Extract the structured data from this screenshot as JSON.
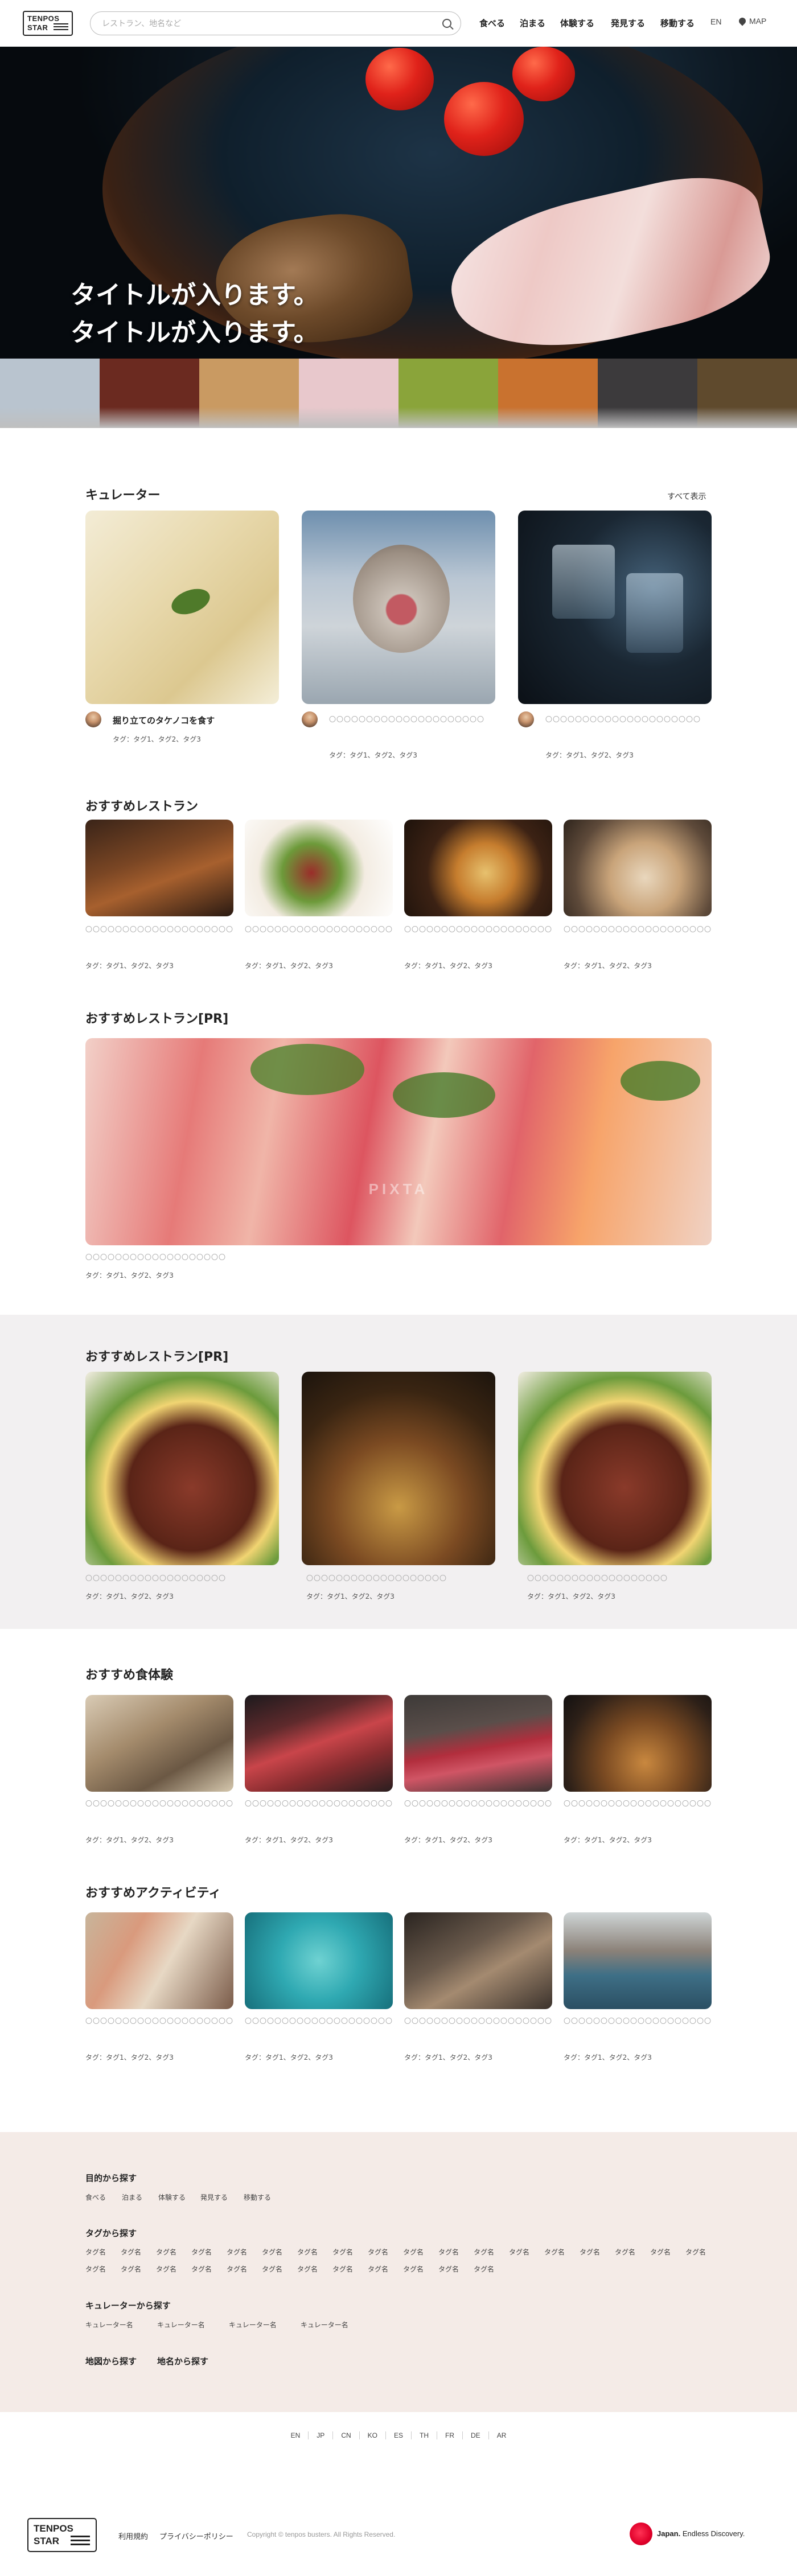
{
  "header": {
    "logo_line1": "TENPOS",
    "logo_line2": "STAR",
    "search_placeholder": "レストラン、地名など",
    "nav": [
      "食べる",
      "泊まる",
      "体験する",
      "発見する",
      "移動する"
    ],
    "lang": "EN",
    "map": "MAP"
  },
  "hero": {
    "title_line1": "タイトルが入ります。",
    "title_line2": "タイトルが入ります。"
  },
  "strip_colors": [
    "#b9c4cf",
    "#6b2a20",
    "#c99a62",
    "#e8c8cc",
    "#8aa43a",
    "#c9722f",
    "#3c3a3c",
    "#5f4a2d"
  ],
  "curators": {
    "title": "キュレーター",
    "see_all": "すべて表示",
    "items": [
      {
        "name": "掘り立てのタケノコを食す",
        "tags": "タグ：タグ1、タグ2、タグ3"
      },
      {
        "name": "〇〇〇〇〇〇〇〇〇〇〇〇〇〇〇〇〇〇〇〇〇",
        "tags": "タグ：タグ1、タグ2、タグ3"
      },
      {
        "name": "〇〇〇〇〇〇〇〇〇〇〇〇〇〇〇〇〇〇〇〇〇",
        "tags": "タグ：タグ1、タグ2、タグ3"
      }
    ]
  },
  "restaurants": {
    "title": "おすすめレストラン",
    "items": [
      {
        "name": "〇〇〇〇〇〇〇〇〇〇〇〇〇〇〇〇〇〇〇〇",
        "tags": "タグ：タグ1、タグ2、タグ3"
      },
      {
        "name": "〇〇〇〇〇〇〇〇〇〇〇〇〇〇〇〇〇〇〇〇",
        "tags": "タグ：タグ1、タグ2、タグ3"
      },
      {
        "name": "〇〇〇〇〇〇〇〇〇〇〇〇〇〇〇〇〇〇〇〇",
        "tags": "タグ：タグ1、タグ2、タグ3"
      },
      {
        "name": "〇〇〇〇〇〇〇〇〇〇〇〇〇〇〇〇〇〇〇〇",
        "tags": "タグ：タグ1、タグ2、タグ3"
      }
    ]
  },
  "pr_big": {
    "title": "おすすめレストラン[PR]",
    "name": "〇〇〇〇〇〇〇〇〇〇〇〇〇〇〇〇〇〇〇",
    "tags": "タグ：タグ1、タグ2、タグ3",
    "watermark": "PIXTA"
  },
  "pr_three": {
    "title": "おすすめレストラン[PR]",
    "items": [
      {
        "name": "〇〇〇〇〇〇〇〇〇〇〇〇〇〇〇〇〇〇〇",
        "tags": "タグ：タグ1、タグ2、タグ3"
      },
      {
        "name": "〇〇〇〇〇〇〇〇〇〇〇〇〇〇〇〇〇〇〇",
        "tags": "タグ：タグ1、タグ2、タグ3"
      },
      {
        "name": "〇〇〇〇〇〇〇〇〇〇〇〇〇〇〇〇〇〇〇",
        "tags": "タグ：タグ1、タグ2、タグ3"
      }
    ]
  },
  "experiences": {
    "title": "おすすめ食体験",
    "items": [
      {
        "name": "〇〇〇〇〇〇〇〇〇〇〇〇〇〇〇〇〇〇〇〇",
        "tags": "タグ：タグ1、タグ2、タグ3"
      },
      {
        "name": "〇〇〇〇〇〇〇〇〇〇〇〇〇〇〇〇〇〇〇〇",
        "tags": "タグ：タグ1、タグ2、タグ3"
      },
      {
        "name": "〇〇〇〇〇〇〇〇〇〇〇〇〇〇〇〇〇〇〇〇",
        "tags": "タグ：タグ1、タグ2、タグ3"
      },
      {
        "name": "〇〇〇〇〇〇〇〇〇〇〇〇〇〇〇〇〇〇〇〇",
        "tags": "タグ：タグ1、タグ2、タグ3"
      }
    ]
  },
  "activities": {
    "title": "おすすめアクティビティ",
    "items": [
      {
        "name": "〇〇〇〇〇〇〇〇〇〇〇〇〇〇〇〇〇〇〇〇",
        "tags": "タグ：タグ1、タグ2、タグ3"
      },
      {
        "name": "〇〇〇〇〇〇〇〇〇〇〇〇〇〇〇〇〇〇〇〇",
        "tags": "タグ：タグ1、タグ2、タグ3"
      },
      {
        "name": "〇〇〇〇〇〇〇〇〇〇〇〇〇〇〇〇〇〇〇〇",
        "tags": "タグ：タグ1、タグ2、タグ3"
      },
      {
        "name": "〇〇〇〇〇〇〇〇〇〇〇〇〇〇〇〇〇〇〇〇",
        "tags": "タグ：タグ1、タグ2、タグ3"
      }
    ]
  },
  "footer": {
    "purpose_title": "目的から探す",
    "purpose_links": [
      "食べる",
      "泊まる",
      "体験する",
      "発見する",
      "移動する"
    ],
    "tag_title": "タグから探す",
    "tag_label": "タグ名",
    "tag_rows": [
      18,
      12
    ],
    "curator_title": "キュレーターから探す",
    "curator_links": [
      "キュレーター名",
      "キュレーター名",
      "キュレーター名",
      "キュレーター名"
    ],
    "map_title": "地図から探す",
    "area_title": "地名から探す",
    "langs": [
      "EN",
      "JP",
      "CN",
      "KO",
      "ES",
      "TH",
      "FR",
      "DE",
      "AR"
    ],
    "logo_line1": "TENPOS",
    "logo_line2": "STAR",
    "terms": "利用規約",
    "privacy": "プライバシーポリシー",
    "copyright": "Copyright © tenpos busters. All Rights Reserved.",
    "japan_brand": "Japan.",
    "japan_tagline": "Endless Discovery."
  }
}
